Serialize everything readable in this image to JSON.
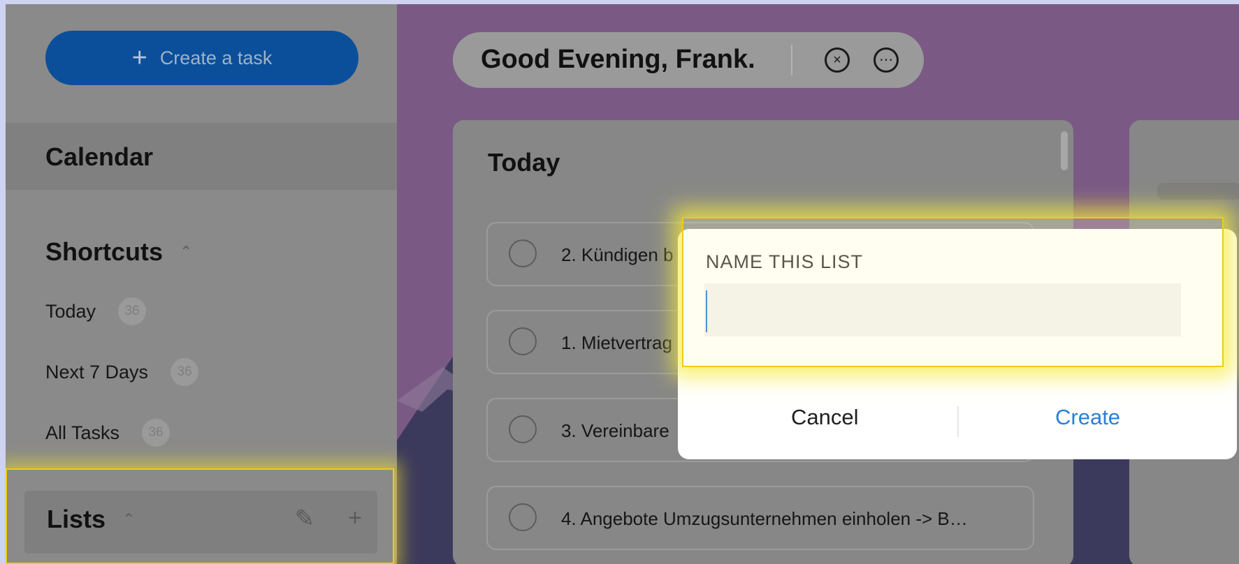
{
  "sidebar": {
    "create_task_label": "Create a task",
    "calendar_label": "Calendar",
    "shortcuts": {
      "title": "Shortcuts",
      "items": [
        {
          "label": "Today",
          "count": "36"
        },
        {
          "label": "Next 7 Days",
          "count": "36"
        },
        {
          "label": "All Tasks",
          "count": "36"
        }
      ]
    },
    "lists": {
      "title": "Lists"
    }
  },
  "header": {
    "greeting": "Good Evening, Frank."
  },
  "today_panel": {
    "title": "Today",
    "tasks": [
      {
        "text": "2. Kündigen b"
      },
      {
        "text": "1. Mietvertrag"
      },
      {
        "text": "3. Vereinbare"
      },
      {
        "text": "4. Angebote Umzugsunternehmen einholen -> B…"
      }
    ]
  },
  "dialog": {
    "label": "NAME THIS LIST",
    "input_value": "",
    "cancel_label": "Cancel",
    "create_label": "Create"
  },
  "colors": {
    "accent_blue": "#0b4f9a",
    "create_text": "#2a7fd8",
    "highlight": "#f0cc10"
  },
  "icons": {
    "create_task": "plus-icon",
    "clear": "circle-x-icon",
    "more": "circle-more-icon",
    "edit": "pencil-icon",
    "add_list": "plus-icon",
    "collapse": "chevron-up-icon"
  }
}
